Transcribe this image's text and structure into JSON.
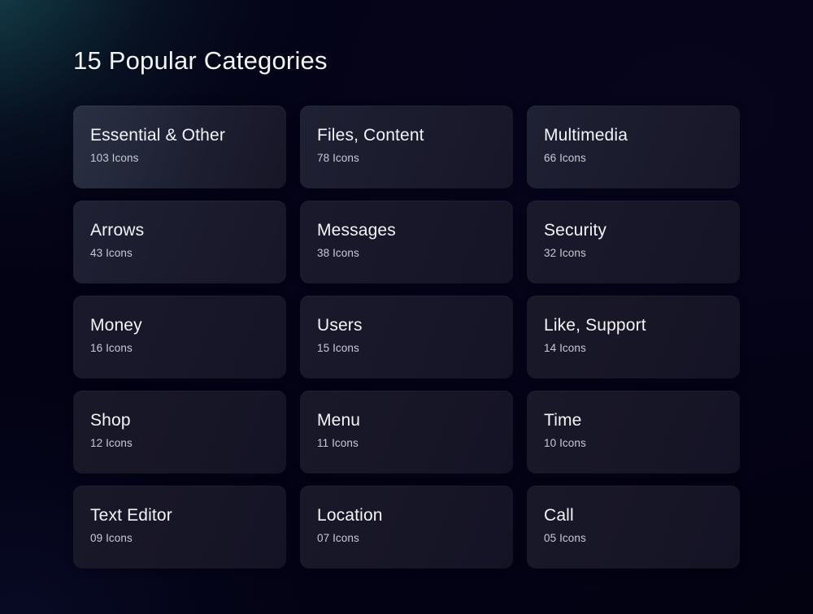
{
  "page": {
    "title": "15 Popular Categories",
    "background_start": "#0a1a25",
    "background_end": "#040318",
    "accent_glow": "#1a545d"
  },
  "card_style": {
    "title_color": "#f3f4f8",
    "count_color": "#c7cad5",
    "surface_color": "#17162a",
    "surface_highlight": "#2a3043"
  },
  "categories": [
    {
      "name": "Essential & Other",
      "count": "103 Icons"
    },
    {
      "name": "Files, Content",
      "count": "78 Icons"
    },
    {
      "name": "Multimedia",
      "count": "66 Icons"
    },
    {
      "name": "Arrows",
      "count": "43 Icons"
    },
    {
      "name": "Messages",
      "count": "38 Icons"
    },
    {
      "name": "Security",
      "count": "32 Icons"
    },
    {
      "name": "Money",
      "count": "16 Icons"
    },
    {
      "name": "Users",
      "count": "15 Icons"
    },
    {
      "name": "Like, Support",
      "count": "14 Icons"
    },
    {
      "name": "Shop",
      "count": "12 Icons"
    },
    {
      "name": "Menu",
      "count": "11 Icons"
    },
    {
      "name": "Time",
      "count": "10 Icons"
    },
    {
      "name": "Text Editor",
      "count": "09 Icons"
    },
    {
      "name": "Location",
      "count": "07 Icons"
    },
    {
      "name": "Call",
      "count": "05 Icons"
    }
  ]
}
